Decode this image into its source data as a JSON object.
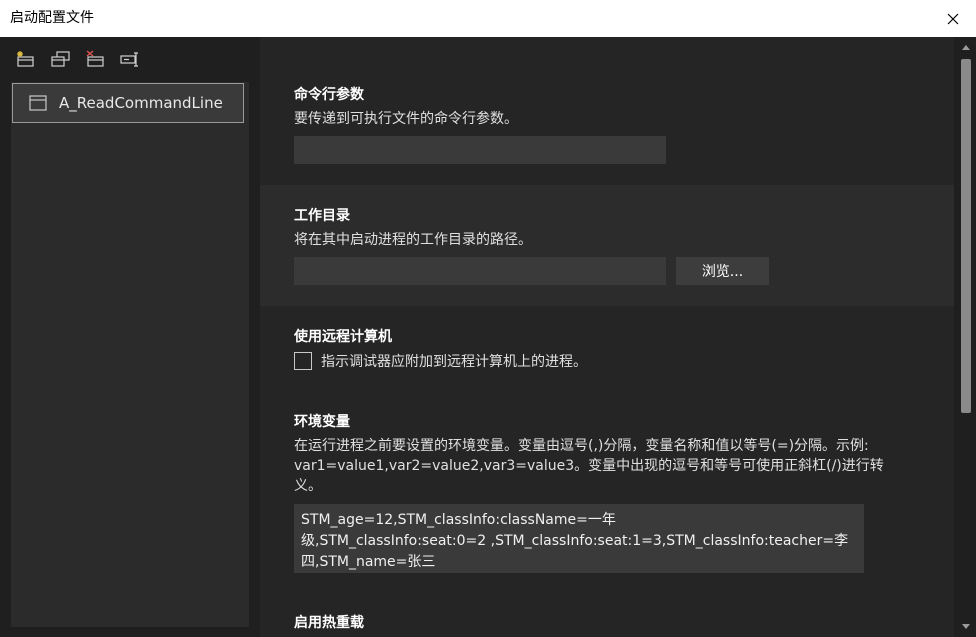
{
  "window": {
    "title": "启动配置文件"
  },
  "toolbar": {
    "icons": [
      "new-profile-icon",
      "copy-profile-icon",
      "delete-profile-icon",
      "rename-profile-icon"
    ]
  },
  "profiles": [
    {
      "label": "A_ReadCommandLine",
      "selected": true
    }
  ],
  "sections": {
    "command_args": {
      "title": "命令行参数",
      "desc": "要传递到可执行文件的命令行参数。",
      "value": ""
    },
    "working_dir": {
      "title": "工作目录",
      "desc": "将在其中启动进程的工作目录的路径。",
      "value": "",
      "browse_label": "浏览..."
    },
    "remote": {
      "title": "使用远程计算机",
      "checkbox_label": "指示调试器应附加到远程计算机上的进程。",
      "checked": false
    },
    "env": {
      "title": "环境变量",
      "desc_lines": [
        "在运行进程之前要设置的环境变量。变量由逗号(,)分隔，变量名称和值以等号(=)分隔。示例:",
        "var1=value1,var2=value2,var3=value3。变量中出现的逗号和等号可使用正斜杠(/)进行转",
        "义。"
      ],
      "value_lines": [
        "STM_age=12,STM_classInfo:className=一年",
        "级,STM_classInfo:seat:0=2 ,STM_classInfo:seat:1=3,STM_classInfo:teacher=李",
        "四,STM_name=张三"
      ]
    },
    "hot_reload": {
      "title": "启用热重载"
    }
  },
  "colors": {
    "background": "#1f1f1f",
    "panel": "#2b2b2b",
    "input": "#3a3a3a",
    "titlebar": "#ffffff"
  }
}
